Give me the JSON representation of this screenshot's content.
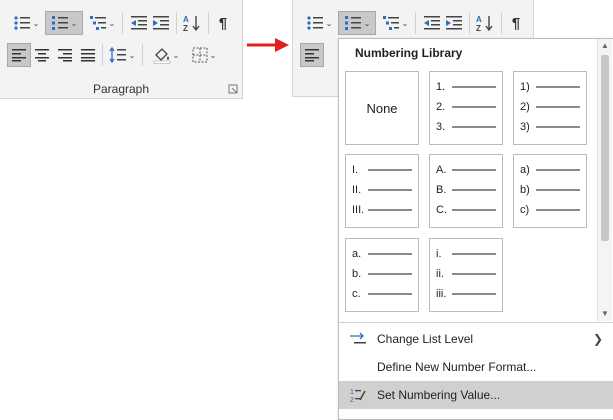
{
  "ribbon": {
    "group_label": "Paragraph"
  },
  "dropdown": {
    "library_title": "Numbering Library",
    "tiles": [
      {
        "kind": "none",
        "label": "None"
      },
      {
        "kind": "list",
        "items": [
          "1.",
          "2.",
          "3."
        ]
      },
      {
        "kind": "list",
        "items": [
          "1)",
          "2)",
          "3)"
        ]
      },
      {
        "kind": "list",
        "items": [
          "I.",
          "II.",
          "III."
        ]
      },
      {
        "kind": "list",
        "items": [
          "A.",
          "B.",
          "C."
        ]
      },
      {
        "kind": "list",
        "items": [
          "a)",
          "b)",
          "c)"
        ]
      },
      {
        "kind": "list",
        "items": [
          "a.",
          "b.",
          "c."
        ]
      },
      {
        "kind": "list",
        "items": [
          "i.",
          "ii.",
          "iii."
        ]
      }
    ],
    "menu": [
      {
        "label": "Change List Level",
        "icon": "change-list-level-icon",
        "submenu": true
      },
      {
        "label": "Define New Number Format...",
        "icon": "",
        "submenu": false
      },
      {
        "label": "Set Numbering Value...",
        "icon": "set-numbering-value-icon",
        "submenu": false
      }
    ]
  },
  "colors": {
    "arrow": "#e02020",
    "selected": "#c8c8c8",
    "icon_blue": "#2b6cc4"
  }
}
